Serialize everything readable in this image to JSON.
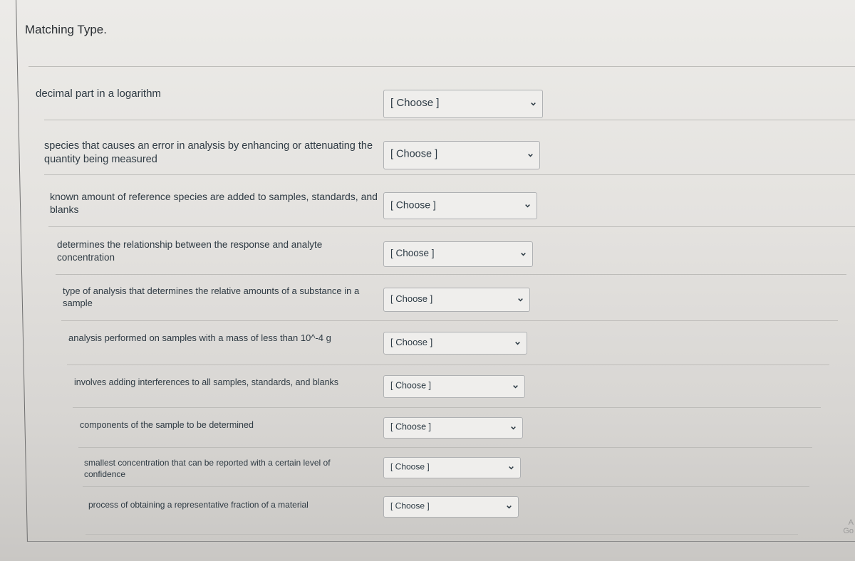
{
  "title": "Matching Type.",
  "placeholder": "[ Choose ]",
  "items": [
    {
      "label": "decimal part in a logarithm"
    },
    {
      "label": "species that causes an error in analysis by enhancing or attenuating the quantity being measured"
    },
    {
      "label": "known amount of reference species are added to samples, standards, and blanks"
    },
    {
      "label": "determines the relationship between the response and analyte concentration"
    },
    {
      "label": "type of analysis that determines the relative amounts of a substance in a sample"
    },
    {
      "label": "analysis performed on samples with a mass of less than 10^-4 g"
    },
    {
      "label": "involves adding interferences to all samples, standards, and blanks"
    },
    {
      "label": "components of the sample to be determined"
    },
    {
      "label": "smallest concentration that can be reported with a certain level of confidence"
    },
    {
      "label": "process of obtaining a representative fraction of a material"
    }
  ],
  "corner_text": [
    "A",
    "Go"
  ]
}
